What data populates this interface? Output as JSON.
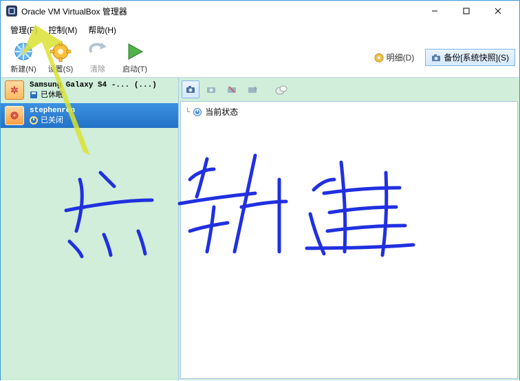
{
  "titlebar": {
    "title": "Oracle VM VirtualBox 管理器"
  },
  "menu": {
    "file": "管理(F)",
    "control": "控制(M)",
    "help": "帮助(H)"
  },
  "toolbar": {
    "new": "新建(N)",
    "settings": "设置(S)",
    "discard": "清除",
    "start": "启动(T)",
    "details": "明细(D)",
    "snapshot": "备份[系统快照](S)"
  },
  "vms": [
    {
      "name": "Samsung Galaxy S4 -... (...)",
      "state": "已休眠"
    },
    {
      "name": "stephenren",
      "state": "已关闭"
    }
  ],
  "snapshot_panel": {
    "current_state": "当前状态"
  }
}
